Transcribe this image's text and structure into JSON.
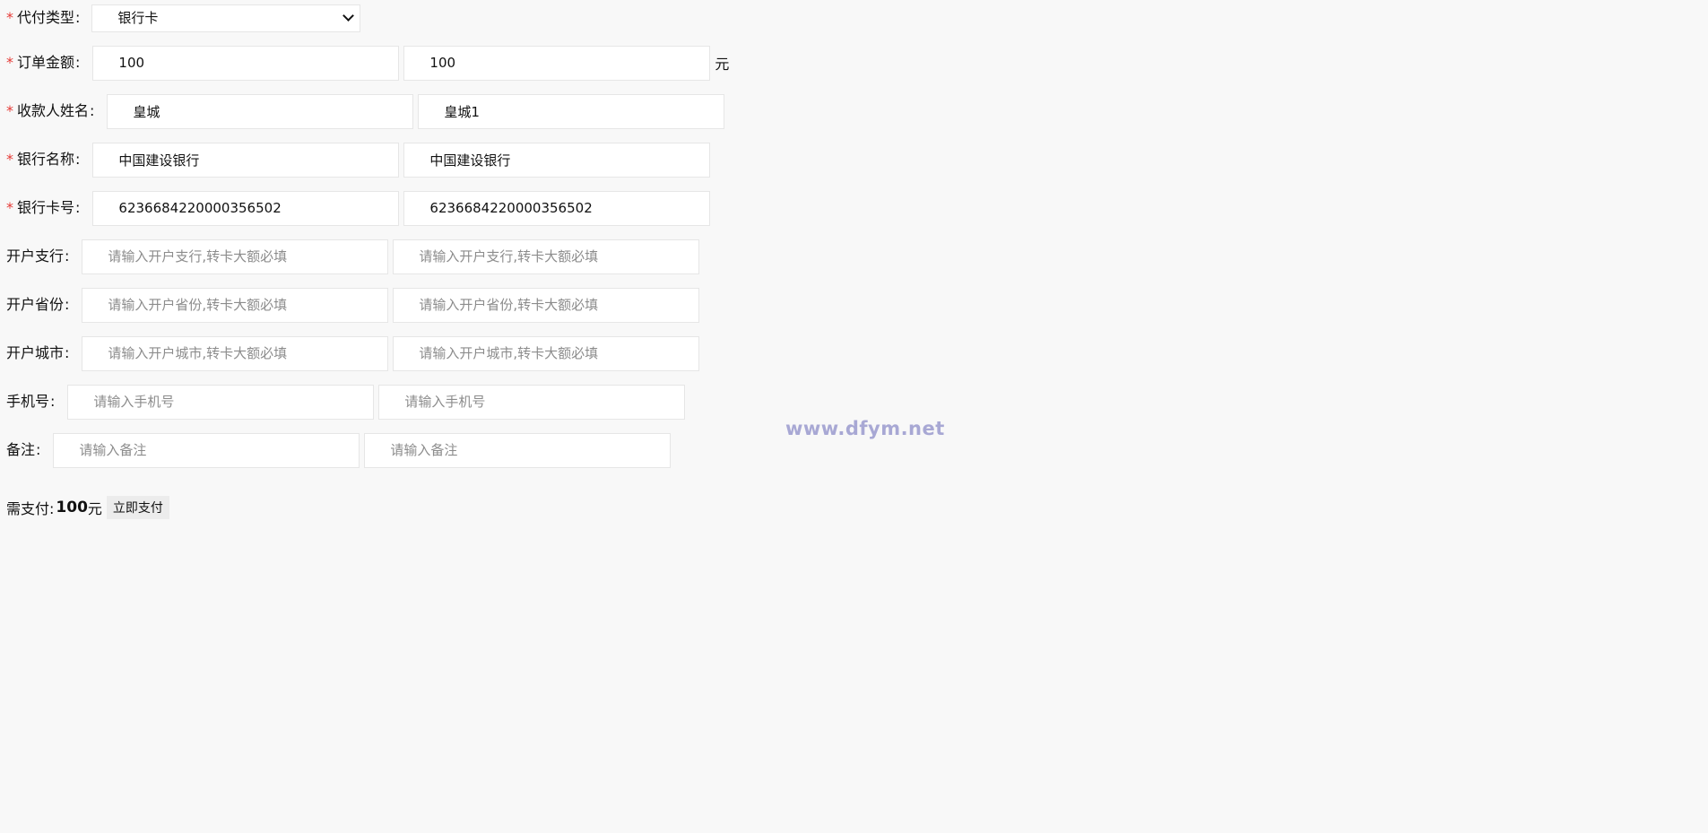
{
  "form": {
    "pay_type": {
      "label": "代付类型",
      "required_mark": "*",
      "colon": ":",
      "value": "银行卡"
    },
    "order_amount": {
      "label": "订单金额",
      "required_mark": "*",
      "colon": ":",
      "value1": "100",
      "value2": "100",
      "unit": "元"
    },
    "payee_name": {
      "label": "收款人姓名",
      "required_mark": "*",
      "colon": ":",
      "value1": "皇城",
      "value2": "皇城1"
    },
    "bank_name": {
      "label": "银行名称",
      "required_mark": "*",
      "colon": ":",
      "value1": "中国建设银行",
      "value2": "中国建设银行"
    },
    "card_number": {
      "label": "银行卡号",
      "required_mark": "*",
      "colon": ":",
      "value1": "6236684220000356502",
      "value2": "6236684220000356502"
    },
    "branch": {
      "label": "开户支行",
      "colon": ":",
      "placeholder": "请输入开户支行,转卡大额必填"
    },
    "province": {
      "label": "开户省份",
      "colon": ":",
      "placeholder": "请输入开户省份,转卡大额必填"
    },
    "city": {
      "label": "开户城市",
      "colon": ":",
      "placeholder": "请输入开户城市,转卡大额必填"
    },
    "phone": {
      "label": "手机号",
      "colon": ":",
      "placeholder": "请输入手机号"
    },
    "remark": {
      "label": "备注",
      "colon": ":",
      "placeholder": "请输入备注"
    }
  },
  "payment": {
    "label": "需支付:",
    "amount": "100",
    "unit": "元",
    "button_label": "立即支付"
  },
  "watermark": "www.dfym.net"
}
